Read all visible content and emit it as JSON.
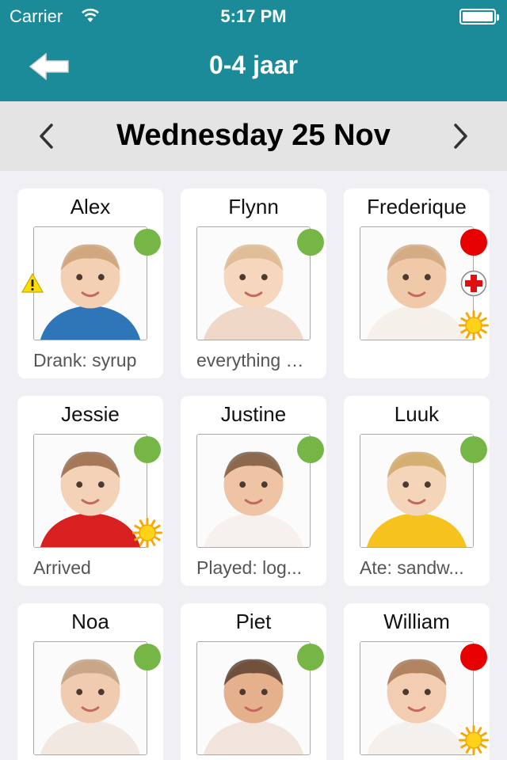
{
  "status_bar": {
    "carrier": "Carrier",
    "time": "5:17 PM"
  },
  "nav": {
    "title": "0-4 jaar"
  },
  "date_bar": {
    "date": "Wednesday 25 Nov"
  },
  "colors": {
    "header": "#1b8a99",
    "present": "#76b646",
    "absent": "#e60000"
  },
  "children": [
    {
      "name": "Alex",
      "status": "green",
      "caption": "Drank: syrup",
      "icons": [
        "warning-icon"
      ]
    },
    {
      "name": "Flynn",
      "status": "green",
      "caption": "everything went well",
      "icons": []
    },
    {
      "name": "Frederique",
      "status": "red",
      "caption": "",
      "icons": [
        "medical-cross-icon",
        "sun-icon"
      ]
    },
    {
      "name": "Jessie",
      "status": "green",
      "caption": "Arrived",
      "icons": [
        "sun-icon"
      ]
    },
    {
      "name": "Justine",
      "status": "green",
      "caption": "Played: log...",
      "icons": []
    },
    {
      "name": "Luuk",
      "status": "green",
      "caption": "Ate: sandw...",
      "icons": []
    },
    {
      "name": "Noa",
      "status": "green",
      "caption": "",
      "icons": []
    },
    {
      "name": "Piet",
      "status": "green",
      "caption": "",
      "icons": []
    },
    {
      "name": "William",
      "status": "red",
      "caption": "",
      "icons": [
        "sun-icon"
      ]
    }
  ]
}
